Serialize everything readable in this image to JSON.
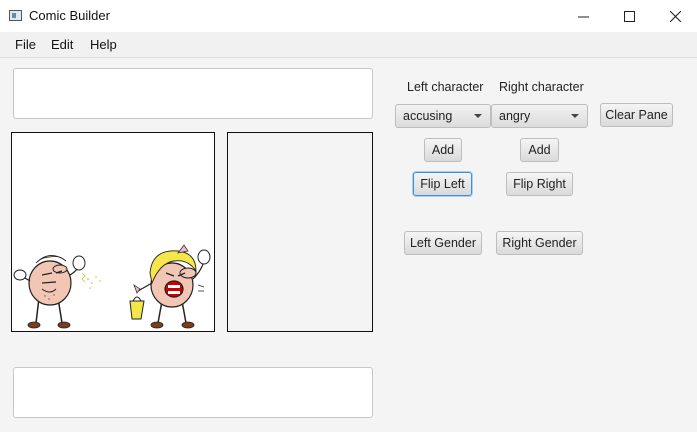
{
  "window": {
    "title": "Comic Builder",
    "controls": {
      "minimize": "–",
      "maximize": "☐",
      "close": "✕"
    }
  },
  "menu": {
    "file": "File",
    "edit": "Edit",
    "help": "Help"
  },
  "captions": {
    "top_value": "",
    "bottom_value": ""
  },
  "characters": {
    "left_label": "Left character",
    "right_label": "Right character",
    "left_selected": "accusing",
    "right_selected": "angry"
  },
  "buttons": {
    "clear_pane": "Clear Pane",
    "add_left": "Add",
    "add_right": "Add",
    "flip_left": "Flip Left",
    "flip_right": "Flip Right",
    "left_gender": "Left Gender",
    "right_gender": "Right Gender"
  },
  "colors": {
    "focus_ring": "#3f8ed8",
    "hair": "#f5e64a",
    "skin": "#f2c6b4"
  }
}
